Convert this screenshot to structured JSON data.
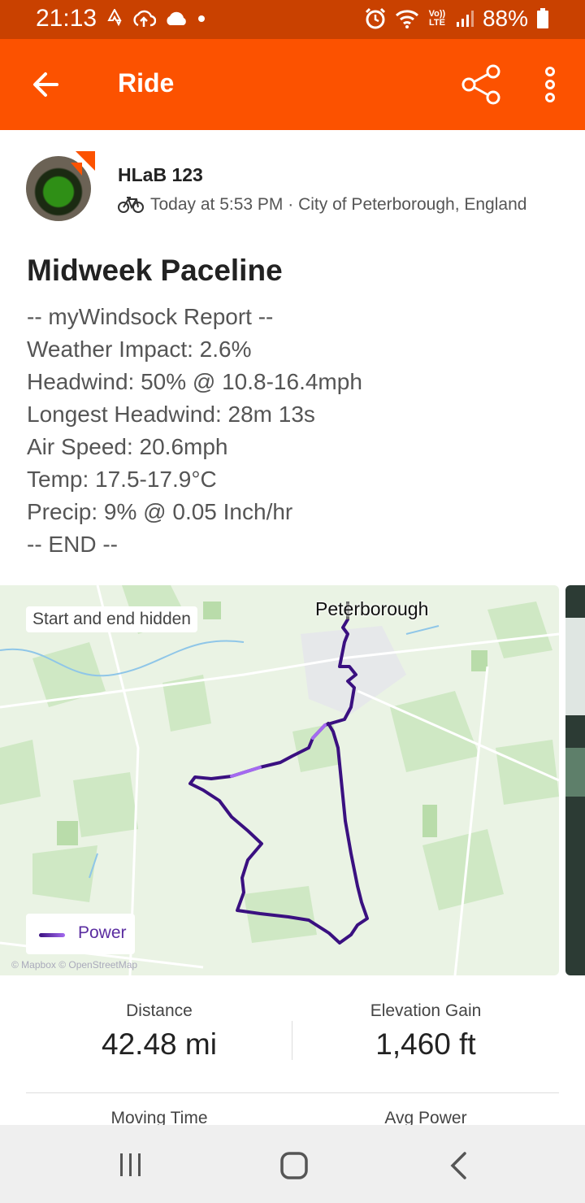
{
  "status_bar": {
    "time": "21:13",
    "battery": "88%",
    "icons_left": [
      "strava-notification-icon",
      "cloud-upload-icon",
      "cloud-icon",
      "dot-icon"
    ],
    "icons_right": [
      "alarm-icon",
      "wifi-icon",
      "volte-icon",
      "signal-icon",
      "battery-icon"
    ],
    "volte_label": "Vo)) LTE"
  },
  "app_bar": {
    "title": "Ride",
    "background": "#fc5200"
  },
  "athlete": {
    "name": "HLaB 123",
    "meta": "Today at 5:53 PM · City of Peterborough, England",
    "activity_icon": "bike-icon"
  },
  "activity": {
    "title": "Midweek Paceline",
    "description_lines": [
      "-- myWindsock Report --",
      "Weather Impact: 2.6%",
      "Headwind: 50% @ 10.8-16.4mph",
      "Longest Headwind: 28m 13s",
      "Air Speed: 20.6mph",
      "Temp: 17.5-17.9°C",
      "Precip: 9% @ 0.05 Inch/hr",
      "-- END --"
    ]
  },
  "map": {
    "city_label": "Peterborough",
    "privacy_chip": "Start and end hidden",
    "legend_label": "Power",
    "attribution": "© Mapbox © OpenStreetMap",
    "route_color": "#3a1080"
  },
  "stats": [
    {
      "label": "Distance",
      "value": "42.48 mi"
    },
    {
      "label": "Elevation Gain",
      "value": "1,460 ft"
    },
    {
      "label": "Moving Time",
      "value": ""
    },
    {
      "label": "Avg Power",
      "value": ""
    }
  ],
  "nav_bar": {
    "buttons": [
      "recents-icon",
      "home-icon",
      "back-icon"
    ]
  }
}
